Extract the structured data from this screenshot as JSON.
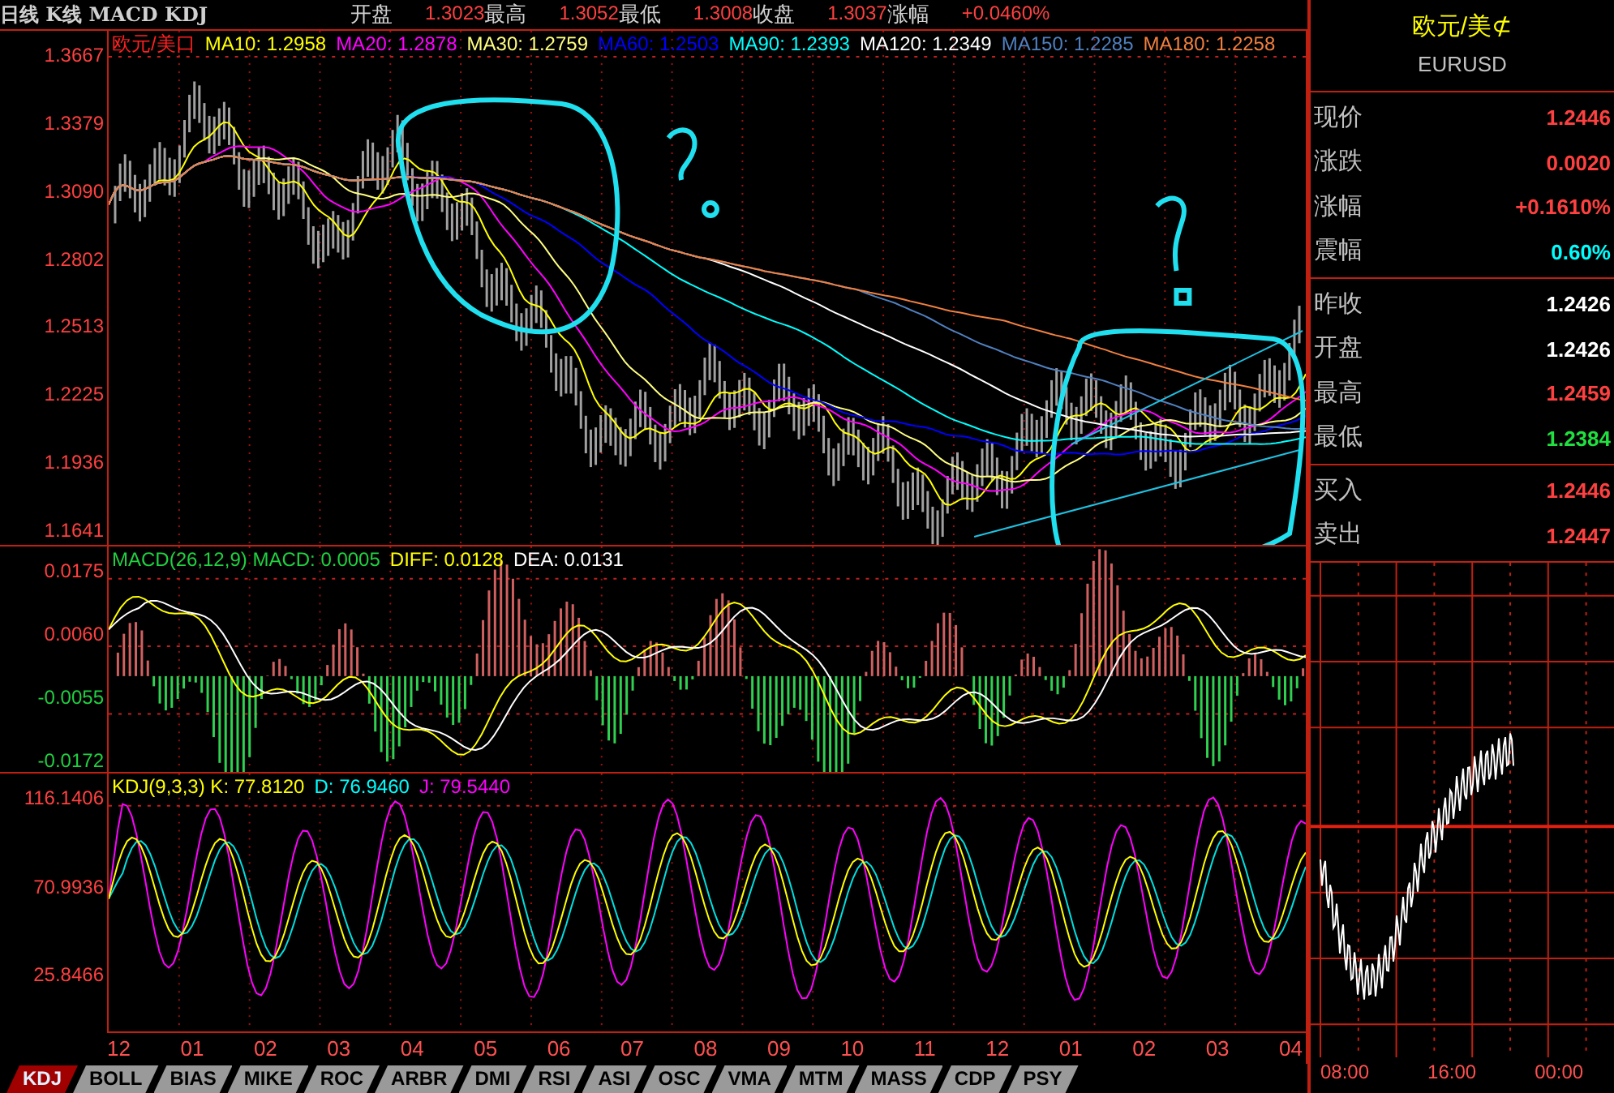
{
  "header": {
    "title": "日线 K线 MACD KDJ",
    "quote": [
      {
        "label": "开盘",
        "value": "1.3023"
      },
      {
        "label": "最高",
        "value": "1.3052"
      },
      {
        "label": "最低",
        "value": "1.3008"
      },
      {
        "label": "收盘",
        "value": "1.3037"
      },
      {
        "label": "涨幅",
        "value": "+0.0460%"
      }
    ]
  },
  "price_panel": {
    "legend": [
      {
        "text": "欧元/美口",
        "color": "#ff2020"
      },
      {
        "text": "MA10: 1.2958",
        "color": "#ffff00"
      },
      {
        "text": "MA20: 1.2878",
        "color": "#ff00ff"
      },
      {
        "text": "MA30: 1.2759",
        "color": "#ffff80"
      },
      {
        "text": "MA60: 1.2503",
        "color": "#0000ff"
      },
      {
        "text": "MA90: 1.2393",
        "color": "#00ffff"
      },
      {
        "text": "MA120: 1.2349",
        "color": "#ffffff"
      },
      {
        "text": "MA150: 1.2285",
        "color": "#5080c0"
      },
      {
        "text": "MA180: 1.2258",
        "color": "#f08040"
      }
    ],
    "y_labels": [
      {
        "text": "1.3667",
        "color": "#ff4040"
      },
      {
        "text": "1.3379",
        "color": "#ff4040"
      },
      {
        "text": "1.3090",
        "color": "#ff4040"
      },
      {
        "text": "1.2802",
        "color": "#ff4040"
      },
      {
        "text": "1.2513",
        "color": "#ff4040"
      },
      {
        "text": "1.2225",
        "color": "#ff4040"
      },
      {
        "text": "1.1936",
        "color": "#ff4040"
      },
      {
        "text": "1.1641",
        "color": "#ff4040"
      }
    ]
  },
  "macd_panel": {
    "legend": [
      {
        "text": "MACD(26,12,9) MACD: 0.0005",
        "color": "#20d040"
      },
      {
        "text": "DIFF: 0.0128",
        "color": "#ffff00"
      },
      {
        "text": "DEA: 0.0131",
        "color": "#ffffff"
      }
    ],
    "y_labels": [
      {
        "text": "0.0175",
        "color": "#ff4040"
      },
      {
        "text": "0.0060",
        "color": "#ff4040"
      },
      {
        "text": "-0.0055",
        "color": "#20d040"
      },
      {
        "text": "-0.0172",
        "color": "#20d040"
      }
    ]
  },
  "kdj_panel": {
    "legend": [
      {
        "text": "KDJ(9,3,3) K: 77.8120",
        "color": "#ffff00"
      },
      {
        "text": "D: 76.9460",
        "color": "#00ffff"
      },
      {
        "text": "J: 79.5440",
        "color": "#ff00ff"
      }
    ],
    "y_labels": [
      {
        "text": "116.1406",
        "color": "#ff4040"
      },
      {
        "text": "70.9936",
        "color": "#ff4040"
      },
      {
        "text": "25.8466",
        "color": "#ff4040"
      }
    ]
  },
  "x_labels": [
    "12",
    "01",
    "02",
    "03",
    "04",
    "05",
    "06",
    "07",
    "08",
    "09",
    "10",
    "11",
    "12",
    "01",
    "02",
    "03",
    "04"
  ],
  "tabs": [
    {
      "label": "KDJ",
      "selected": true
    },
    {
      "label": "BOLL",
      "selected": false
    },
    {
      "label": "BIAS",
      "selected": false
    },
    {
      "label": "MIKE",
      "selected": false
    },
    {
      "label": "ROC",
      "selected": false
    },
    {
      "label": "ARBR",
      "selected": false
    },
    {
      "label": "DMI",
      "selected": false
    },
    {
      "label": "RSI",
      "selected": false
    },
    {
      "label": "ASI",
      "selected": false
    },
    {
      "label": "OSC",
      "selected": false
    },
    {
      "label": "VMA",
      "selected": false
    },
    {
      "label": "MTM",
      "selected": false
    },
    {
      "label": "MASS",
      "selected": false
    },
    {
      "label": "CDP",
      "selected": false
    },
    {
      "label": "PSY",
      "selected": false
    }
  ],
  "quote_panel": {
    "name": "欧元/美⊄",
    "symbol": "EURUSD",
    "sections": [
      [
        {
          "label": "现价",
          "value": "1.2446",
          "color": "#ff4040"
        },
        {
          "label": "涨跌",
          "value": "0.0020",
          "color": "#ff4040"
        },
        {
          "label": "涨幅",
          "value": "+0.1610%",
          "color": "#ff4040"
        },
        {
          "label": "震幅",
          "value": "0.60%",
          "color": "#00ffff"
        }
      ],
      [
        {
          "label": "昨收",
          "value": "1.2426",
          "color": "#ffffff"
        },
        {
          "label": "开盘",
          "value": "1.2426",
          "color": "#ffffff"
        },
        {
          "label": "最高",
          "value": "1.2459",
          "color": "#ff4040"
        },
        {
          "label": "最低",
          "value": "1.2384",
          "color": "#20e040"
        }
      ],
      [
        {
          "label": "买入",
          "value": "1.2446",
          "color": "#ff4040"
        },
        {
          "label": "卖出",
          "value": "1.2447",
          "color": "#ff4040"
        }
      ]
    ],
    "time_labels": [
      "08:00",
      "16:00",
      "00:00"
    ]
  }
}
